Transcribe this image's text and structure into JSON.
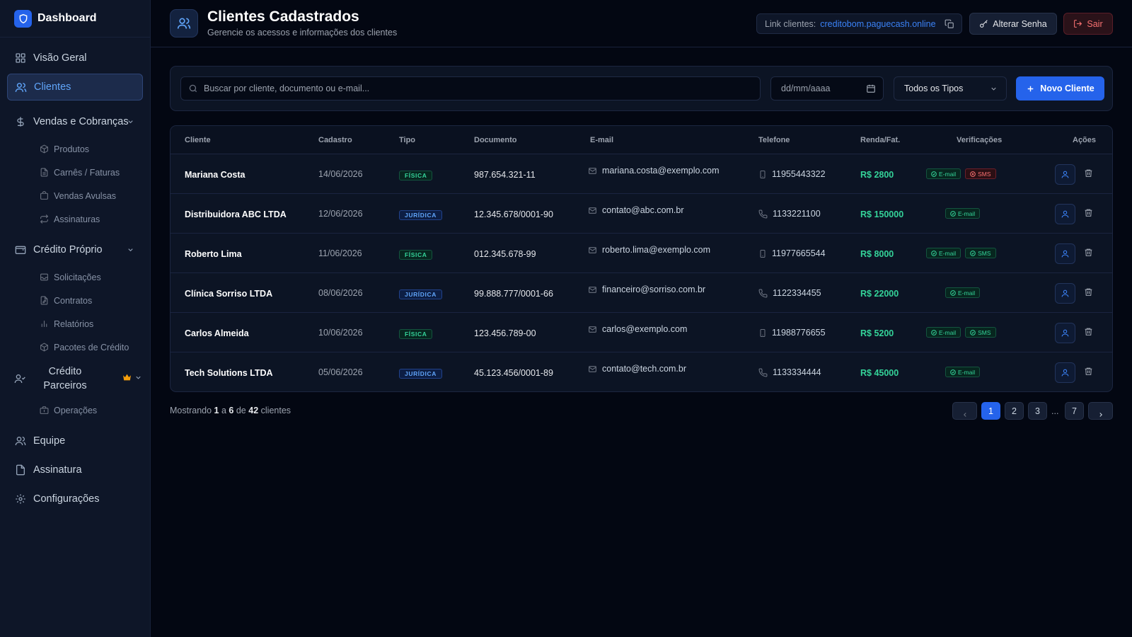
{
  "sidebar": {
    "brand": "Dashboard",
    "items": {
      "visao_geral": "Visão Geral",
      "clientes": "Clientes",
      "vendas": "Vendas e Cobranças",
      "vendas_sub": [
        "Produtos",
        "Carnês / Faturas",
        "Vendas Avulsas",
        "Assinaturas"
      ],
      "credito_proprio": "Crédito Próprio",
      "credito_sub": [
        "Solicitações",
        "Contratos",
        "Relatórios",
        "Pacotes de Crédito"
      ],
      "credito_parceiros_1": "Crédito",
      "credito_parceiros_2": "Parceiros",
      "parceiros_sub": [
        "Operações"
      ],
      "equipe": "Equipe",
      "assinatura": "Assinatura",
      "configuracoes": "Configurações"
    }
  },
  "header": {
    "title": "Clientes Cadastrados",
    "subtitle": "Gerencie os acessos e informações dos clientes",
    "link_label": "Link clientes:",
    "link_url": "creditobom.paguecash.online",
    "alterar_senha": "Alterar Senha",
    "sair": "Sair"
  },
  "filters": {
    "search_placeholder": "Buscar por cliente, documento ou e-mail...",
    "date_placeholder": "dd/mm/aaaa",
    "type_select": "Todos os Tipos",
    "novo_cliente": "Novo Cliente"
  },
  "table": {
    "columns": {
      "cliente": "Cliente",
      "cadastro": "Cadastro",
      "tipo": "Tipo",
      "documento": "Documento",
      "email": "E-mail",
      "telefone": "Telefone",
      "renda": "Renda/Fat.",
      "verificacoes": "Verificações",
      "acoes": "Ações"
    },
    "verif_email": "E-mail",
    "verif_sms": "SMS",
    "rows": [
      {
        "name": "Mariana Costa",
        "date": "14/06/2026",
        "type": "FÍSICA",
        "doc": "987.654.321-11",
        "email": "mariana.costa@exemplo.com",
        "phone": "11955443322",
        "renda": "R$ 2800"
      },
      {
        "name": "Distribuidora ABC LTDA",
        "date": "12/06/2026",
        "type": "JURÍDICA",
        "doc": "12.345.678/0001-90",
        "email": "contato@abc.com.br",
        "phone": "1133221100",
        "renda": "R$ 150000"
      },
      {
        "name": "Roberto Lima",
        "date": "11/06/2026",
        "type": "FÍSICA",
        "doc": "012.345.678-99",
        "email": "roberto.lima@exemplo.com",
        "phone": "11977665544",
        "renda": "R$ 8000"
      },
      {
        "name": "Clínica Sorriso LTDA",
        "date": "08/06/2026",
        "type": "JURÍDICA",
        "doc": "99.888.777/0001-66",
        "email": "financeiro@sorriso.com.br",
        "phone": "1122334455",
        "renda": "R$ 22000"
      },
      {
        "name": "Carlos Almeida",
        "date": "10/06/2026",
        "type": "FÍSICA",
        "doc": "123.456.789-00",
        "email": "carlos@exemplo.com",
        "phone": "11988776655",
        "renda": "R$ 5200"
      },
      {
        "name": "Tech Solutions LTDA",
        "date": "05/06/2026",
        "type": "JURÍDICA",
        "doc": "45.123.456/0001-89",
        "email": "contato@tech.com.br",
        "phone": "1133334444",
        "renda": "R$ 45000"
      }
    ]
  },
  "footer": {
    "mostrando": "Mostrando",
    "from": "1",
    "a": "a",
    "to": "6",
    "de": "de",
    "total": "42",
    "clientes": "clientes",
    "pages": [
      "1",
      "2",
      "3",
      "7"
    ],
    "ellipsis": "..."
  }
}
